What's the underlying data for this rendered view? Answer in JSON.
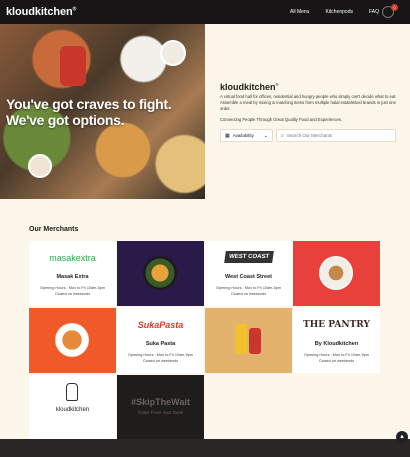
{
  "nav": {
    "brand": "kloudkitchen",
    "links": [
      "All Menu",
      "Kitchenpods",
      "FAQ"
    ],
    "cart_count": "0"
  },
  "hero": {
    "line1": "You've got craves to fight.",
    "line2": "We've got options.",
    "brand": "kloudkitchen",
    "description": "A virtual food hall for offices, residential and hungry people who simply can't decide what to eat. Assemble a meal by mixing & matching items from multiple halal established brands in just one order.",
    "tagline": "Connecting People Through Great Quality Food and Experiences.",
    "availability_label": "Availability",
    "search_placeholder": "Search Our Merchants"
  },
  "merchants": {
    "title": "Our Merchants",
    "cards": [
      {
        "logo": "masakextra",
        "name": "Masak Extra",
        "hours": "Opening Hours : Mon to Fri 10am-5pm",
        "closed": "Closed on weekends"
      },
      {
        "logo": "",
        "name": "",
        "hours": "",
        "closed": ""
      },
      {
        "logo": "WEST COAST",
        "name": "West Coast Street",
        "hours": "Opening Hours : Mon to Fri 10am-5pm",
        "closed": "Closed on weekends"
      },
      {
        "logo": "",
        "name": "",
        "hours": "",
        "closed": ""
      },
      {
        "logo": "",
        "name": "",
        "hours": "",
        "closed": ""
      },
      {
        "logo": "SukaPasta",
        "name": "Suka Pasta",
        "hours": "Opening Hours : Mon to Fri 10am-5pm",
        "closed": "Closed on weekends"
      },
      {
        "logo": "",
        "name": "",
        "hours": "",
        "closed": ""
      },
      {
        "logo": "THE PANTRY",
        "name": "By Kloudkitchen",
        "hours": "Opening Hours : Mon to Fri 10am-5pm",
        "closed": "Closed on weekends"
      },
      {
        "logo": "",
        "name": "kloudkitchen",
        "hours": "",
        "closed": ""
      },
      {
        "logo": "#SkipTheWait",
        "name": "Order From Your Desk",
        "hours": "",
        "closed": ""
      }
    ]
  },
  "colors": {
    "nav_bg": "#171515",
    "page_bg": "#fcf7ea",
    "accent_red": "#d63b2a",
    "masak_green": "#2aa84a",
    "card_orange": "#f05a28",
    "card_red": "#e8403a",
    "card_purple": "#2a1a4a",
    "card_tan": "#e3b36e",
    "card_dark": "#1f1c1c"
  }
}
